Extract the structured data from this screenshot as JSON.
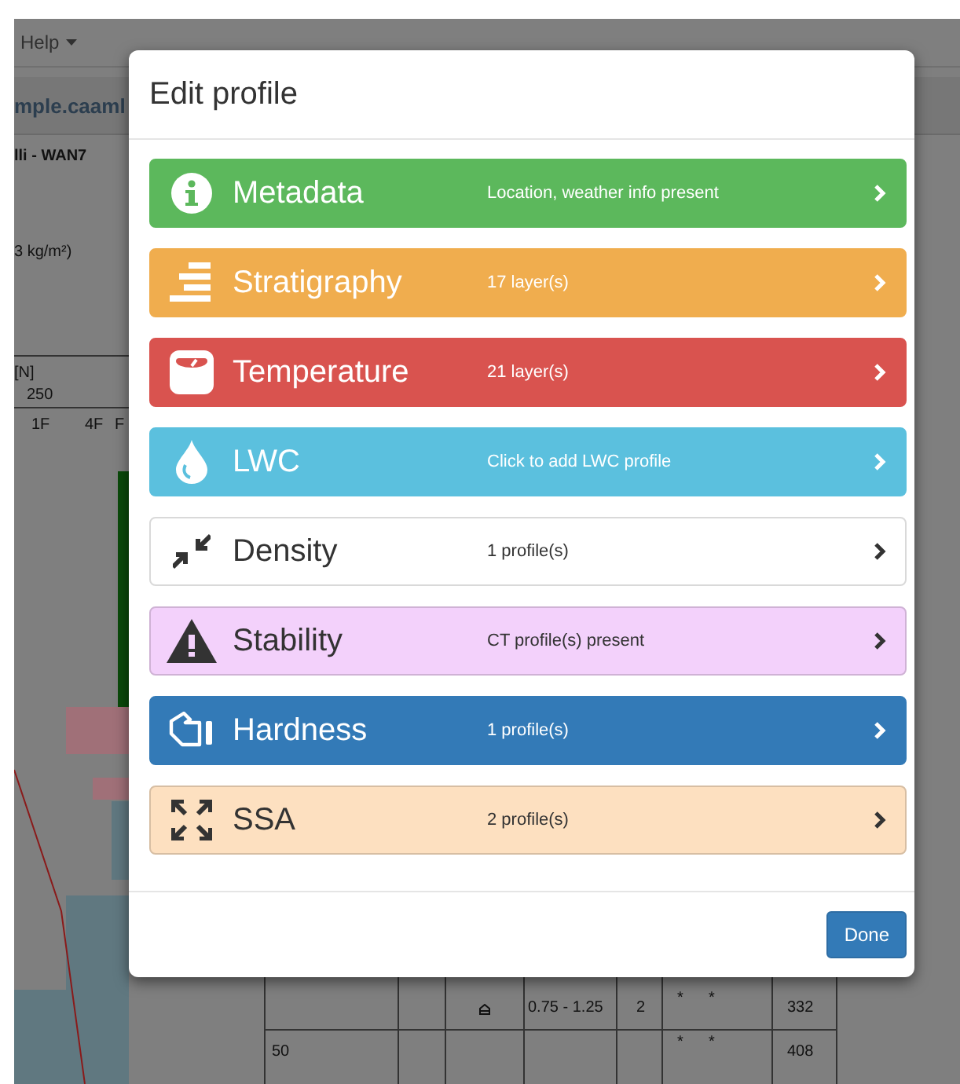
{
  "background": {
    "menu": "Help",
    "tab": "mple.caaml",
    "site": "lli - WAN7",
    "swe": "3 kg/m²)",
    "axis_unit": "[N]",
    "axis_value": "250",
    "hardness_ticks": [
      "1F",
      "4F",
      "F"
    ],
    "table_rows": [
      {
        "size": "0.75 - 1.25",
        "hardness": "2",
        "stars": [
          "*",
          "*"
        ],
        "density": "332"
      },
      {
        "depth": "50",
        "stars": [
          "*",
          "*"
        ],
        "density": "408"
      }
    ]
  },
  "dialog": {
    "title": "Edit profile",
    "items": [
      {
        "kind": "info",
        "label": "Metadata",
        "summary": "Location, weather info present",
        "color": "#5cb85c"
      },
      {
        "kind": "layers",
        "label": "Stratigraphy",
        "summary": "17 layer(s)",
        "color": "#f0ad4e"
      },
      {
        "kind": "scale",
        "label": "Temperature",
        "summary": "21 layer(s)",
        "color": "#d9534f"
      },
      {
        "kind": "drop",
        "label": "LWC",
        "summary": "Click to add LWC profile",
        "color": "#5bc0de"
      },
      {
        "kind": "compress",
        "label": "Density",
        "summary": "1 profile(s)",
        "color": "#ffffff"
      },
      {
        "kind": "warning",
        "label": "Stability",
        "summary": "CT profile(s) present",
        "color": "#f3d1fb"
      },
      {
        "kind": "hand",
        "label": "Hardness",
        "summary": "1 profile(s)",
        "color": "#337ab7"
      },
      {
        "kind": "expand",
        "label": "SSA",
        "summary": "2 profile(s)",
        "color": "#fde0c0"
      }
    ],
    "done": "Done"
  }
}
